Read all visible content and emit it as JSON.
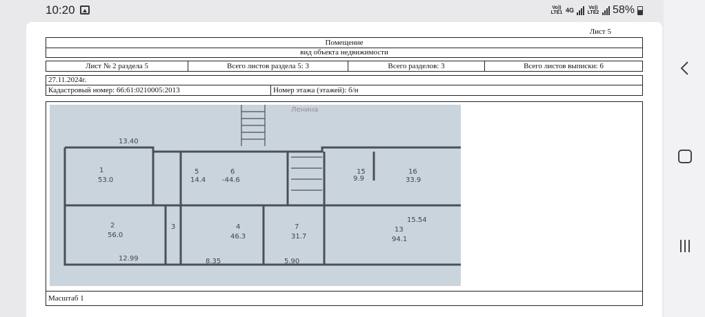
{
  "status": {
    "time": "10:20",
    "net1": "Vo)) LTE1",
    "net4g": "4G",
    "net2": "Vo)) LTE2",
    "battery": "58%"
  },
  "doc": {
    "sheet": "Лист 5",
    "title": "Помещение",
    "subtitle": "вид объекта недвижимости",
    "cells": [
      "Лист № 2 раздела 5",
      "Всего листов раздела 5: 3",
      "Всего разделов: 3",
      "Всего листов выписки: 6"
    ],
    "date": "27.11.2024г.",
    "cadastral": "Кадастровый номер: 66:61:0210005:2013",
    "floor": "Номер этажа (этажей): б/н",
    "scale": "Масштаб 1"
  },
  "nav": {
    "back": "back-icon",
    "home": "home-icon",
    "recent": "recent-apps-icon"
  }
}
